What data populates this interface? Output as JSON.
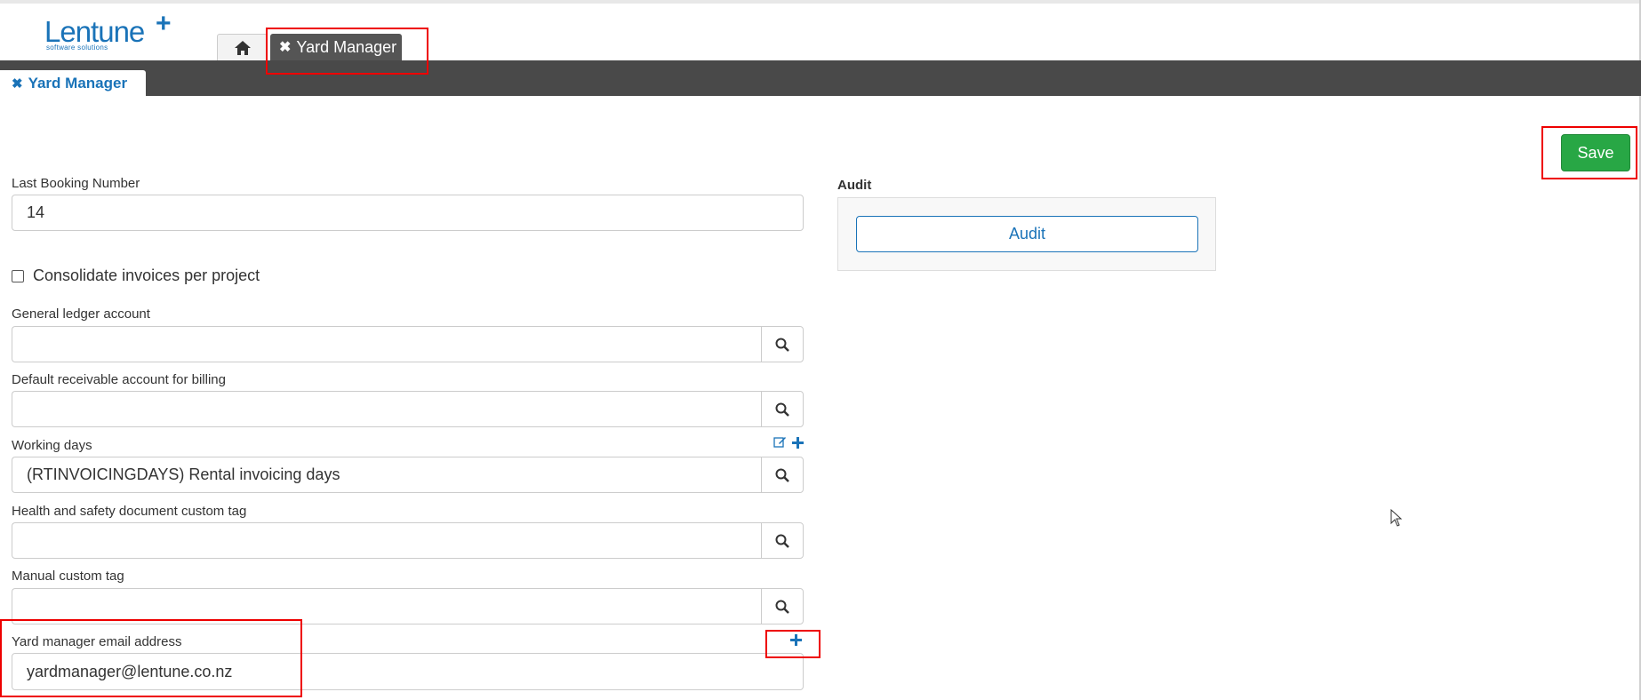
{
  "logo": {
    "name": "Lentune",
    "sub": "software solutions"
  },
  "tabs": {
    "home_icon": "home-icon",
    "app_tab_label": "Yard Manager"
  },
  "subtab": {
    "label": "Yard Manager"
  },
  "toolbar": {
    "save_label": "Save"
  },
  "form": {
    "last_booking_label": "Last Booking Number",
    "last_booking_value": "14",
    "consolidate_label": "Consolidate invoices per project",
    "gl_label": "General ledger account",
    "gl_value": "",
    "receivable_label": "Default receivable account for billing",
    "receivable_value": "",
    "working_days_label": "Working days",
    "working_days_value": "(RTINVOICINGDAYS) Rental invoicing days",
    "health_label": "Health and safety document custom tag",
    "health_value": "",
    "manual_label": "Manual custom tag",
    "manual_value": "",
    "email_label": "Yard manager email address",
    "email_value": "yardmanager@lentune.co.nz"
  },
  "audit": {
    "label": "Audit",
    "button_label": "Audit"
  },
  "colors": {
    "accent": "#1a73b8",
    "save": "#28a745",
    "darkbar": "#494949",
    "highlight": "#e00000"
  }
}
